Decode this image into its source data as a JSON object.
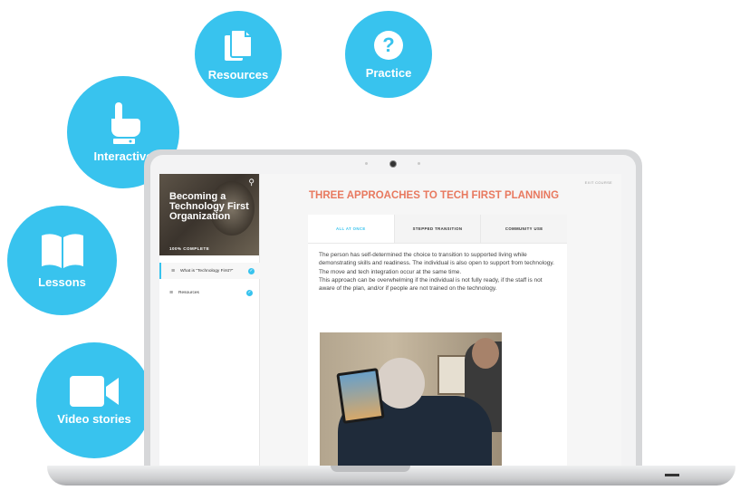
{
  "bubbles": {
    "resources": {
      "label": "Resources",
      "icon": "documents-icon"
    },
    "practice": {
      "label": "Practice",
      "icon": "question-icon"
    },
    "interactive": {
      "label": "Interactive",
      "icon": "pointer-hand-icon"
    },
    "lessons": {
      "label": "Lessons",
      "icon": "book-icon"
    },
    "video": {
      "label": "Video stories",
      "icon": "video-camera-icon"
    },
    "color": "#38c3ee"
  },
  "sidebar": {
    "course_title": "Becoming a Technology First Organization",
    "progress_text": "100% COMPLETE",
    "progress": 1.0,
    "items": [
      {
        "label": "What is \"Technology First?\"",
        "complete": true,
        "active": true
      },
      {
        "label": "Resources",
        "complete": true,
        "active": false
      }
    ]
  },
  "main": {
    "exit_label": "EXIT COURSE",
    "title": "THREE APPROACHES TO TECH FIRST PLANNING",
    "tabs": [
      {
        "label": "ALL AT ONCE",
        "active": true
      },
      {
        "label": "STEPPED TRANSITION",
        "active": false
      },
      {
        "label": "COMMUNITY USE",
        "active": false
      }
    ],
    "paragraph1": "The person has self-determined the choice to transition to supported living while demonstrating skills and readiness.  The individual is also open to support from technology.  The move and tech integration occur at the same time.",
    "paragraph2": "This approach can be overwhelming if the individual is not fully ready, if the staff is not aware of the plan, and/or if people are not trained on the technology."
  },
  "colors": {
    "accent": "#38c3ee",
    "title": "#e8795f"
  }
}
